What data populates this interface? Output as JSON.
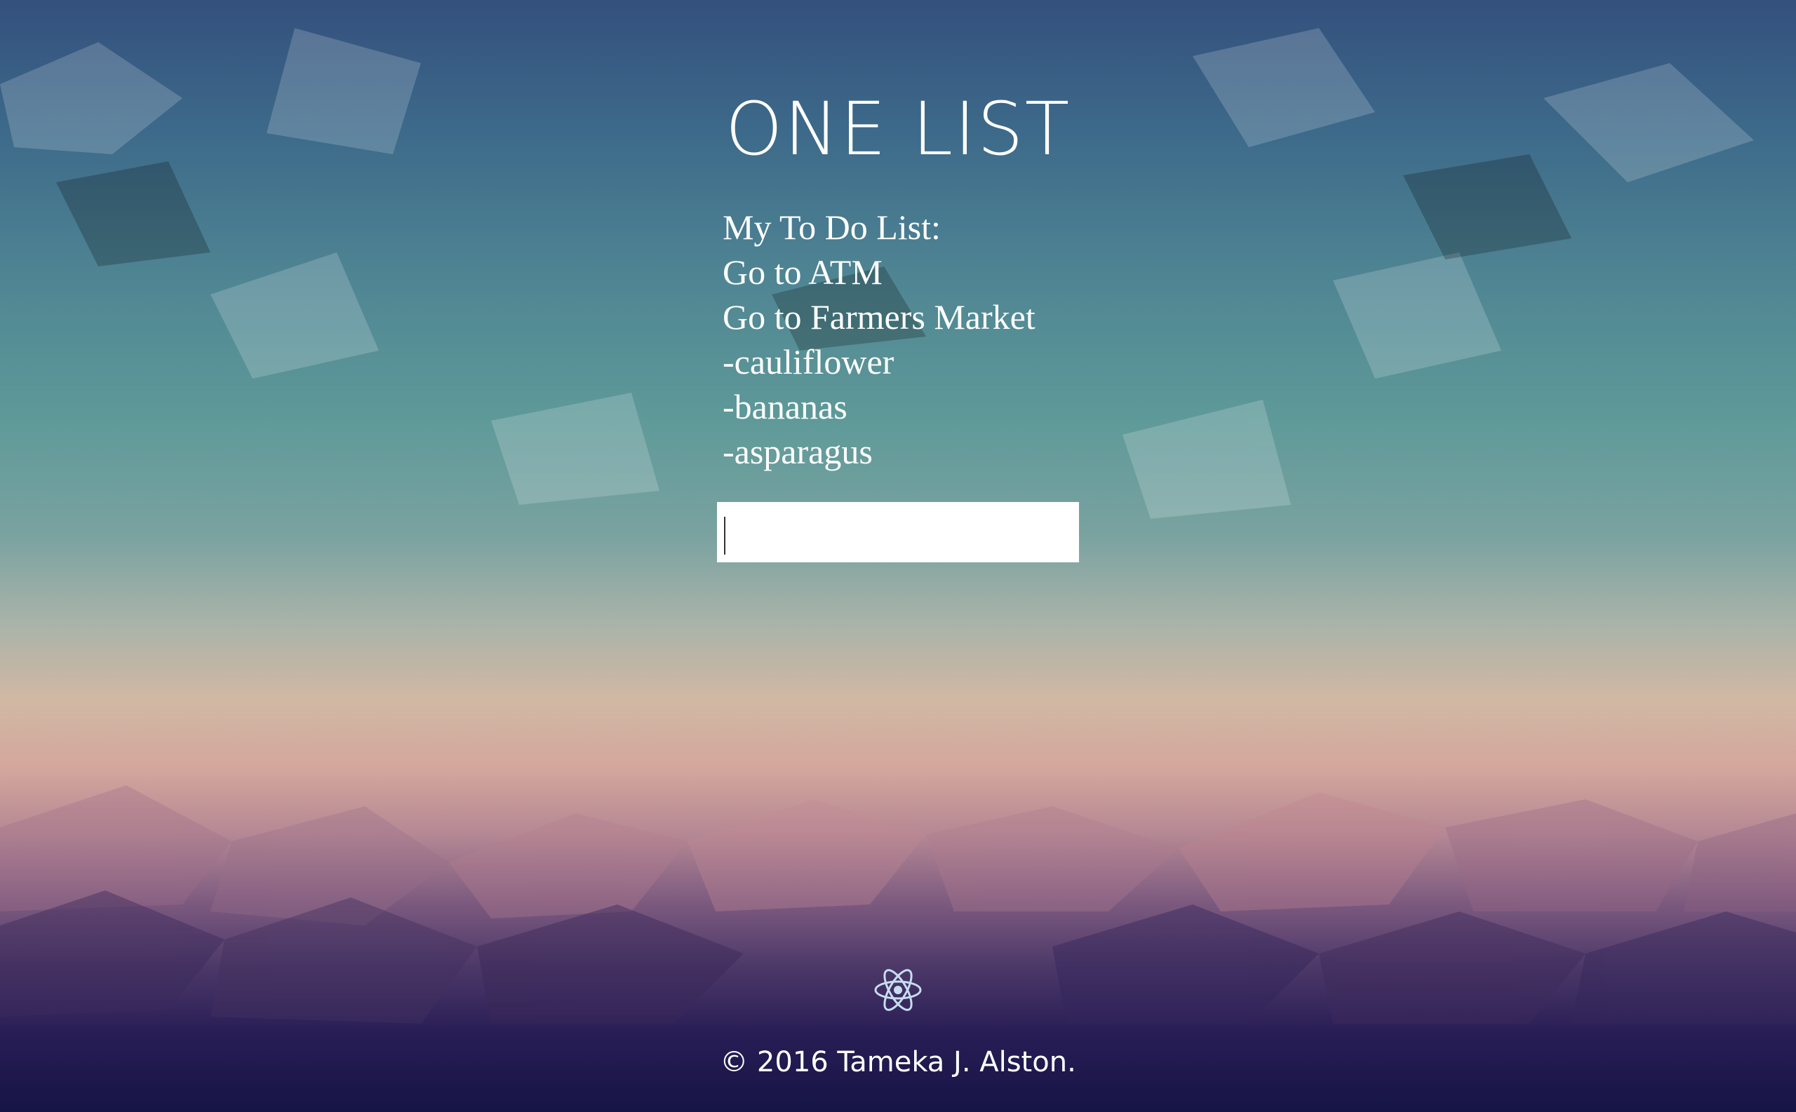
{
  "app": {
    "title": "ONE LIST"
  },
  "todo": {
    "items": [
      "My To Do List:",
      "Go to ATM",
      "Go to Farmers Market",
      "-cauliflower",
      "-bananas",
      "-asparagus"
    ],
    "input_value": "",
    "input_placeholder": ""
  },
  "footer": {
    "logo_icon": "react-atom-icon",
    "copyright": "© 2016 Tameka J. Alston."
  },
  "colors": {
    "text": "#ffffff",
    "input_bg": "#ffffff",
    "logo_stroke": "#c7dcf0"
  }
}
